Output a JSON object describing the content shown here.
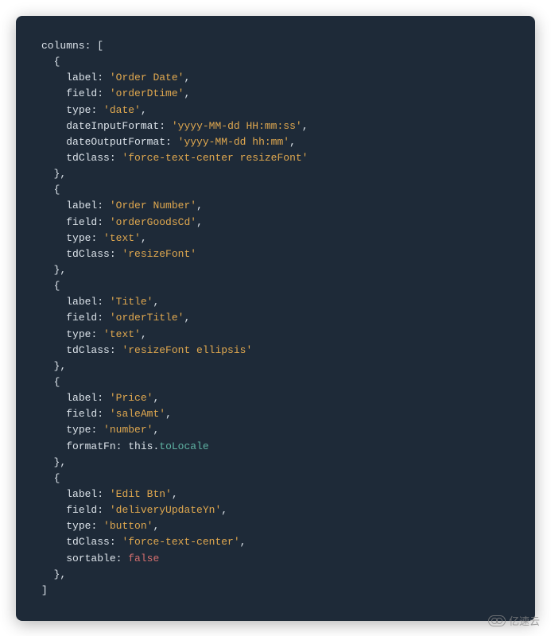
{
  "code": {
    "columnsKey": "columns",
    "entries": [
      {
        "props": [
          {
            "key": "label",
            "value": "'Order Date'",
            "cls": "string"
          },
          {
            "key": "field",
            "value": "'orderDtime'",
            "cls": "string"
          },
          {
            "key": "type",
            "value": "'date'",
            "cls": "string"
          },
          {
            "key": "dateInputFormat",
            "value": "'yyyy-MM-dd HH:mm:ss'",
            "cls": "string"
          },
          {
            "key": "dateOutputFormat",
            "value": "'yyyy-MM-dd hh:mm'",
            "cls": "string"
          },
          {
            "key": "tdClass",
            "value": "'force-text-center resizeFont'",
            "cls": "string"
          }
        ]
      },
      {
        "props": [
          {
            "key": "label",
            "value": "'Order Number'",
            "cls": "string"
          },
          {
            "key": "field",
            "value": "'orderGoodsCd'",
            "cls": "string"
          },
          {
            "key": "type",
            "value": "'text'",
            "cls": "string"
          },
          {
            "key": "tdClass",
            "value": "'resizeFont'",
            "cls": "string"
          }
        ]
      },
      {
        "props": [
          {
            "key": "label",
            "value": "'Title'",
            "cls": "string"
          },
          {
            "key": "field",
            "value": "'orderTitle'",
            "cls": "string"
          },
          {
            "key": "type",
            "value": "'text'",
            "cls": "string"
          },
          {
            "key": "tdClass",
            "value": "'resizeFont ellipsis'",
            "cls": "string"
          }
        ]
      },
      {
        "props": [
          {
            "key": "label",
            "value": "'Price'",
            "cls": "string"
          },
          {
            "key": "field",
            "value": "'saleAmt'",
            "cls": "string"
          },
          {
            "key": "type",
            "value": "'number'",
            "cls": "string"
          },
          {
            "key": "formatFn",
            "value": "this.toLocale",
            "cls": "method-ref"
          }
        ]
      },
      {
        "props": [
          {
            "key": "label",
            "value": "'Edit Btn'",
            "cls": "string"
          },
          {
            "key": "field",
            "value": "'deliveryUpdateYn'",
            "cls": "string"
          },
          {
            "key": "type",
            "value": "'button'",
            "cls": "string"
          },
          {
            "key": "tdClass",
            "value": "'force-text-center'",
            "cls": "string"
          },
          {
            "key": "sortable",
            "value": "false",
            "cls": "false"
          }
        ]
      }
    ]
  },
  "watermark": "亿速云"
}
